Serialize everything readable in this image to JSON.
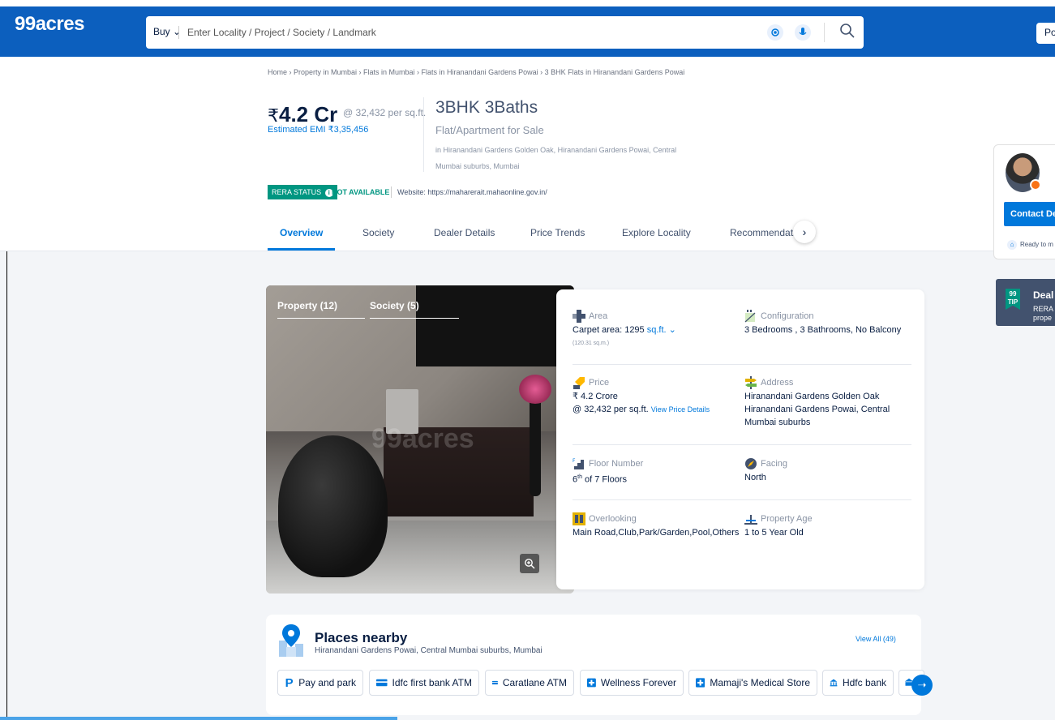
{
  "header": {
    "logo": "99acres",
    "buy_label": "Buy ⌄",
    "search_placeholder": "Enter Locality / Project / Society / Landmark",
    "post_label": "Po"
  },
  "breadcrumb": "Home › Property in Mumbai › Flats in Mumbai › Flats in Hiranandani Gardens Powai › 3 BHK Flats in Hiranandani Gardens Powai",
  "listing": {
    "price_symbol": "₹",
    "price": "4.2 Cr",
    "price_per": "@ 32,432 per sq.ft.",
    "emi": "Estimated EMI ₹3,35,456",
    "bhk": "3BHK 3Baths",
    "type": "Flat/Apartment for Sale",
    "address": "in Hiranandani Gardens Golden Oak, Hiranandani Gardens Powai, Central Mumbai suburbs, Mumbai",
    "rera_status": "RERA STATUS",
    "rera_info": "i",
    "rera_value": "NOT AVAILABLE",
    "rera_site": "Website: https://maharerait.mahaonline.gov.in/"
  },
  "tabs": [
    "Overview",
    "Society",
    "Dealer Details",
    "Price Trends",
    "Explore Locality",
    "Recommendatio"
  ],
  "dealer": {
    "contact_label": "Contact De",
    "ready_label": "Ready to m"
  },
  "deal_tip": {
    "icon_text": "99 TIP",
    "title": "Deal",
    "desc_line1": "RERA",
    "desc_line2": "prope"
  },
  "gallery": {
    "tab_property": "Property (12)",
    "tab_society": "Society (5)",
    "watermark": "99acres"
  },
  "details": {
    "area_label": "Area",
    "area_value": "Carpet area: 1295",
    "area_unit": "sq.ft. ⌄",
    "area_sub": "(120.31 sq.m.)",
    "config_label": "Configuration",
    "config_value": "3 Bedrooms , 3 Bathrooms, No Balcony",
    "price_label": "Price",
    "price_value": "₹ 4.2 Crore",
    "price_per": "@ 32,432 per sq.ft.",
    "price_link": "View Price Details",
    "address_label": "Address",
    "address_value": "Hiranandani Gardens Golden Oak Hiranandani Gardens Powai, Central Mumbai suburbs",
    "floor_label": "Floor Number",
    "floor_num": "6",
    "floor_sup": "th",
    "floor_rest": "of 7 Floors",
    "facing_label": "Facing",
    "facing_value": "North",
    "overlooking_label": "Overlooking",
    "overlooking_value": "Main Road,Club,Park/Garden,Pool,Others",
    "age_label": "Property Age",
    "age_value": "1 to 5 Year Old"
  },
  "places": {
    "title": "Places nearby",
    "subtitle": "Hiranandani Gardens Powai, Central Mumbai suburbs, Mumbai",
    "view_all": "View All (49)",
    "chips": [
      {
        "label": "Pay and park",
        "icon": "parking-icon"
      },
      {
        "label": "Idfc first bank ATM",
        "icon": "atm-card-icon"
      },
      {
        "label": "Caratlane ATM",
        "icon": "atm-card-icon"
      },
      {
        "label": "Wellness Forever",
        "icon": "medical-cross-icon"
      },
      {
        "label": "Mamaji's Medical Store",
        "icon": "medical-cross-icon"
      },
      {
        "label": "Hdfc bank",
        "icon": "bank-icon"
      }
    ]
  },
  "colors": {
    "brand_blue": "#0c5fbe",
    "link_blue": "#0078db",
    "rera_green": "#009681"
  }
}
